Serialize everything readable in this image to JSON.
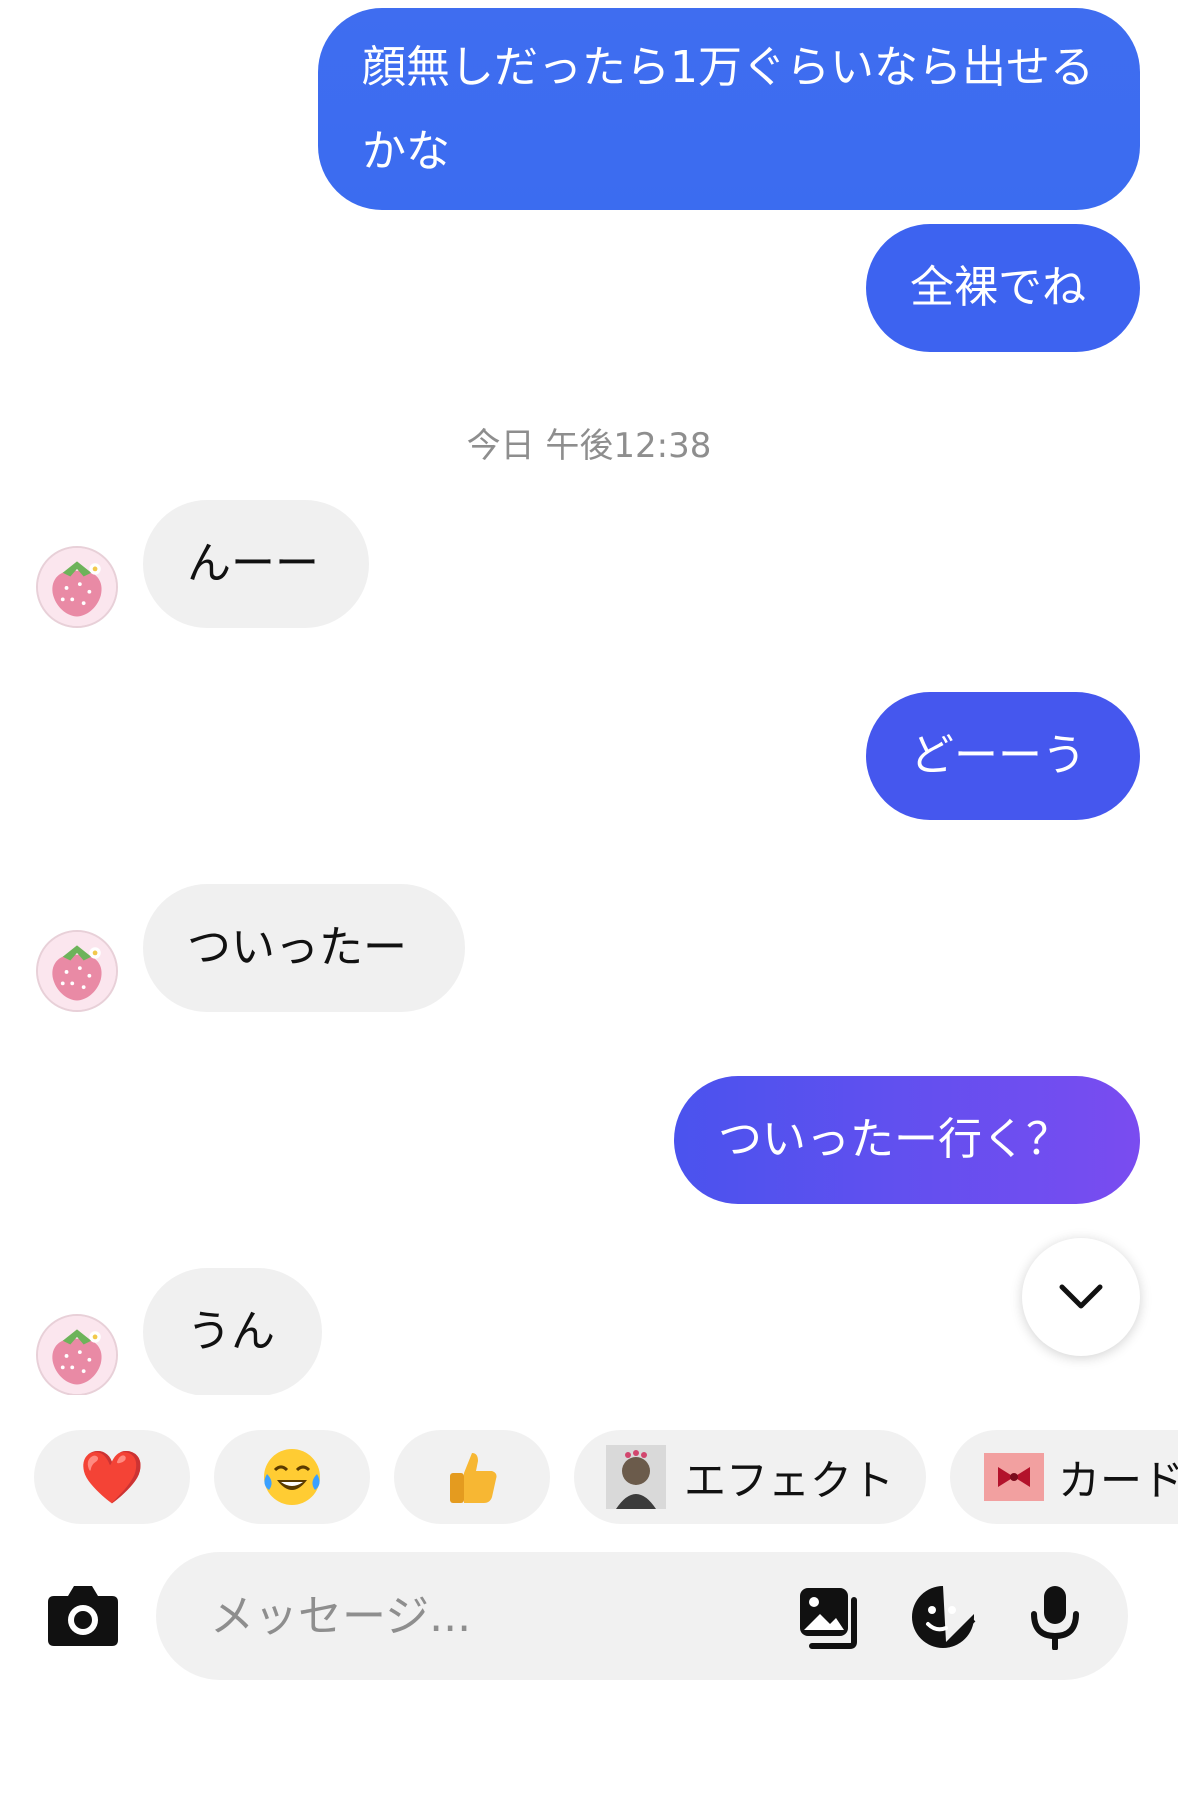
{
  "messages": [
    {
      "id": "m1",
      "direction": "outgoing",
      "text": "顔無しだったら1万ぐらいなら出せるかな"
    },
    {
      "id": "m2",
      "direction": "outgoing",
      "text": "全裸でね"
    },
    {
      "id": "m3",
      "direction": "incoming",
      "text": "んーー"
    },
    {
      "id": "m4",
      "direction": "outgoing",
      "text": "どーーう"
    },
    {
      "id": "m5",
      "direction": "incoming",
      "text": "ついったー"
    },
    {
      "id": "m6",
      "direction": "outgoing",
      "text": "ついったー行く？"
    },
    {
      "id": "m7",
      "direction": "incoming",
      "text": "うん"
    }
  ],
  "timestamp": "今日 午後12:38",
  "contact": {
    "avatar_icon": "strawberry-icon"
  },
  "quick_reactions": [
    {
      "icon": "red-heart-emoji",
      "glyph": "❤️"
    },
    {
      "icon": "tears-of-joy-emoji",
      "glyph": "😂"
    },
    {
      "icon": "thumbs-up-emoji",
      "glyph": "👍"
    }
  ],
  "quick_actions": {
    "effects_label": "エフェクト",
    "cards_label": "カード"
  },
  "composer": {
    "placeholder": "メッセージ..."
  },
  "colors": {
    "outgoing_bubble": "#3d63f0",
    "outgoing_gradient_end": "#7a4cf0",
    "incoming_bubble": "#f0f0f0"
  }
}
